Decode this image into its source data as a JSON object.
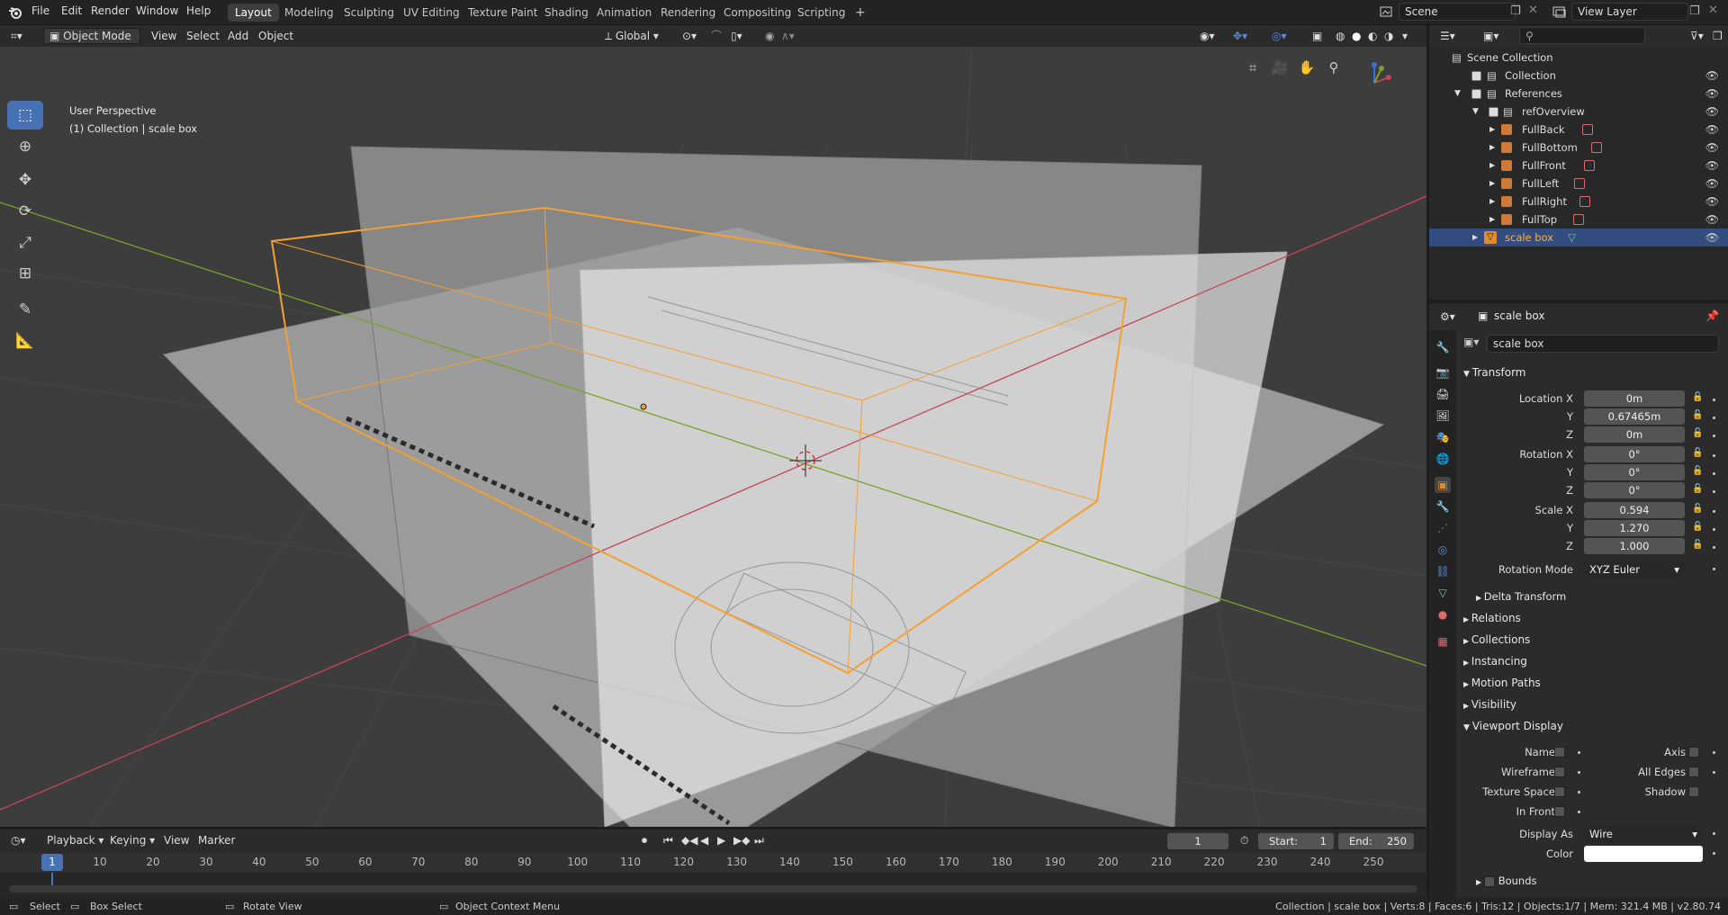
{
  "topbar": {
    "menus": [
      "File",
      "Edit",
      "Render",
      "Window",
      "Help"
    ],
    "workspaces": [
      "Layout",
      "Modeling",
      "Sculpting",
      "UV Editing",
      "Texture Paint",
      "Shading",
      "Animation",
      "Rendering",
      "Compositing",
      "Scripting"
    ],
    "add_tab": "+",
    "scene": "Scene",
    "view_layer": "View Layer"
  },
  "viewport_header": {
    "mode": "Object Mode",
    "menus": [
      "View",
      "Select",
      "Add",
      "Object"
    ],
    "orientation": "Global"
  },
  "viewport": {
    "view_name": "User Perspective",
    "collection_info": "(1) Collection | scale box"
  },
  "toolbar": {
    "tools": [
      "select-box",
      "cursor",
      "move",
      "rotate",
      "scale",
      "transform",
      "annotate",
      "measure"
    ]
  },
  "outliner": {
    "search_placeholder": "",
    "rows": [
      {
        "label": "Scene Collection",
        "indent": 0
      },
      {
        "label": "Collection",
        "indent": 1
      },
      {
        "label": "References",
        "indent": 1
      },
      {
        "label": "refOverview",
        "indent": 2
      },
      {
        "label": "FullBack",
        "indent": 3
      },
      {
        "label": "FullBottom",
        "indent": 3
      },
      {
        "label": "FullFront",
        "indent": 3
      },
      {
        "label": "FullLeft",
        "indent": 3
      },
      {
        "label": "FullRight",
        "indent": 3
      },
      {
        "label": "FullTop",
        "indent": 3
      },
      {
        "label": "scale box",
        "indent": 2
      }
    ]
  },
  "properties": {
    "header_object": "scale box",
    "object_name": "scale box",
    "transform_title": "Transform",
    "location_label": "Location X",
    "location": [
      "0m",
      "0.67465m",
      "0m"
    ],
    "rotation_label": "Rotation X",
    "rotation": [
      "0°",
      "0°",
      "0°"
    ],
    "scale_label": "Scale X",
    "scale": [
      "0.594",
      "1.270",
      "1.000"
    ],
    "axis_y": "Y",
    "axis_z": "Z",
    "rotation_mode_label": "Rotation Mode",
    "rotation_mode": "XYZ Euler",
    "delta_transform": "Delta Transform",
    "sections": [
      "Relations",
      "Collections",
      "Instancing",
      "Motion Paths",
      "Visibility"
    ],
    "viewport_display": "Viewport Display",
    "vd_left": [
      "Name",
      "Wireframe",
      "Texture Space",
      "In Front"
    ],
    "vd_right": [
      "Axis",
      "All Edges",
      "Shadow"
    ],
    "display_as_label": "Display As",
    "display_as": "Wire",
    "color_label": "Color",
    "bounds_label": "Bounds"
  },
  "timeline": {
    "menus": [
      "Playback",
      "Keying",
      "View",
      "Marker"
    ],
    "current_frame": "1",
    "start_label": "Start:",
    "start": "1",
    "end_label": "End:",
    "end": "250",
    "ticks": [
      "1",
      "10",
      "20",
      "30",
      "40",
      "50",
      "60",
      "70",
      "80",
      "90",
      "100",
      "110",
      "120",
      "130",
      "140",
      "150",
      "160",
      "170",
      "180",
      "190",
      "200",
      "210",
      "220",
      "230",
      "240",
      "250"
    ]
  },
  "statusbar": {
    "select": "Select",
    "box_select": "Box Select",
    "rotate_view": "Rotate View",
    "context_menu": "Object Context Menu",
    "stats": "Collection | scale box | Verts:8 | Faces:6 | Tris:12 | Objects:1/7 | Mem: 321.4 MB | v2.80.74"
  },
  "colors": {
    "accent": "#4772b3",
    "selection_orange": "#f5a030",
    "x_axis": "#c5445a",
    "y_axis": "#7aa12a",
    "selected_row": "#334d80"
  }
}
